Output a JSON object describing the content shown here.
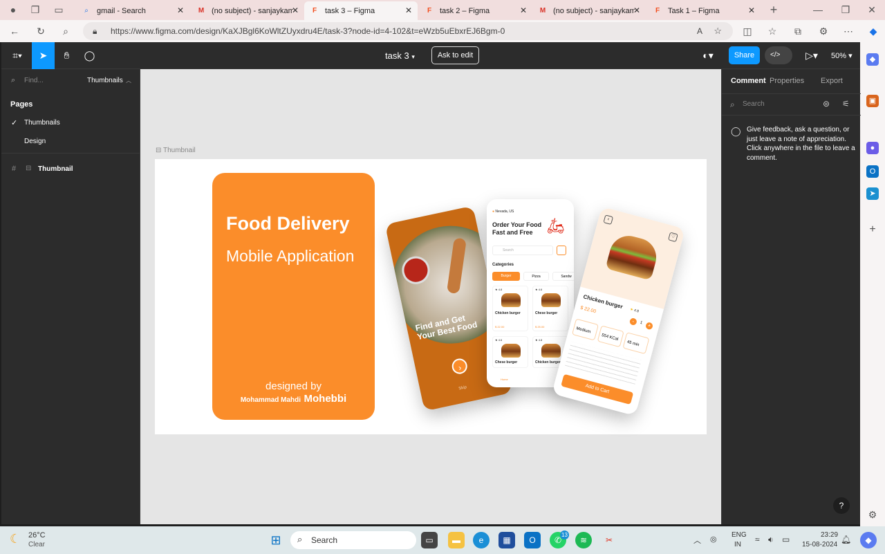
{
  "browser": {
    "tabs": [
      {
        "title": "gmail - Search",
        "icon": "search-icon"
      },
      {
        "title": "(no subject) - sanjaykama",
        "icon": "gmail-icon"
      },
      {
        "title": "task 3 – Figma",
        "icon": "figma-icon",
        "active": true
      },
      {
        "title": "task 2 – Figma",
        "icon": "figma-icon"
      },
      {
        "title": "(no subject) - sanjaykama",
        "icon": "gmail-icon"
      },
      {
        "title": "Task 1 – Figma",
        "icon": "figma-icon"
      }
    ],
    "url": "https://www.figma.com/design/KaXJBgl6KoWltZUyxdru4E/task-3?node-id=4-102&t=eWzb5uEbxrEJ6Bgm-0"
  },
  "figma": {
    "file_title": "task 3",
    "ask_to_edit": "Ask to edit",
    "share": "Share",
    "zoom": "50%",
    "left": {
      "find_placeholder": "Find...",
      "page_dropdown": "Thumbnails",
      "pages_heading": "Pages",
      "pages": [
        "Thumbnails",
        "Design"
      ],
      "layer": "Thumbnail"
    },
    "right": {
      "tabs": [
        "Comment",
        "Properties",
        "Export"
      ],
      "search_placeholder": "Search",
      "hint": "Give feedback, ask a question, or just leave a note of appreciation. Click anywhere in the file to leave a comment."
    },
    "canvas": {
      "frame_label": "Thumbnail",
      "title": "Food Delivery",
      "subtitle": "Mobile Application",
      "designed_by": "designed by",
      "author_first": "Mohammad Mahdi",
      "author_last": "Mohebbi",
      "phone1": {
        "headline": "Find and Get Your Best Food",
        "skip": "Skip"
      },
      "phone2": {
        "location": "Nevada, US",
        "heading": "Order Your Food Fast and Free",
        "search": "Search",
        "categories_label": "Categories",
        "categories": [
          "Burger",
          "Pizza",
          "Sandw"
        ],
        "items": [
          {
            "name": "Chicken burger",
            "price": "$ 22.00",
            "rating": "4.8"
          },
          {
            "name": "Chese burger",
            "price": "$ 25.00",
            "rating": "4.6"
          },
          {
            "name": "Chese burger",
            "rating": "4.6"
          },
          {
            "name": "Chicken burger",
            "rating": "4.8"
          }
        ],
        "nav_home": "Home"
      },
      "phone3": {
        "name": "Chicken burger",
        "price": "$ 22.00",
        "rating": "4.8",
        "qty": "1",
        "size": "Medium",
        "energy": "554 KCal",
        "delivery": "45 min",
        "cta": "Add to Cart"
      }
    }
  },
  "taskbar": {
    "weather_temp": "26°C",
    "weather_desc": "Clear",
    "search": "Search",
    "lang1": "ENG",
    "lang2": "IN",
    "time": "23:29",
    "date": "15-08-2024",
    "whatsapp_badge": "13"
  }
}
